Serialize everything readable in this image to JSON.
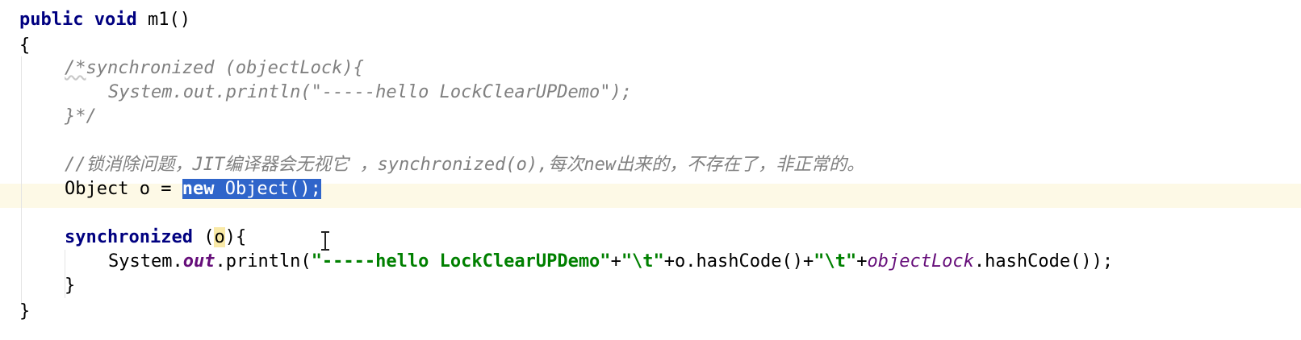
{
  "code": {
    "line1": {
      "kw1": "public",
      "kw2": "void",
      "rest": " m1()"
    },
    "line2": "{",
    "line3": {
      "slash": "/*",
      "rest": "synchronized (objectLock){"
    },
    "line4": "System.out.println(\"-----hello LockClearUPDemo\");",
    "line5": "}*/",
    "line6": "//锁消除问题，JIT编译器会无视它 ，synchronized(o),每次new出来的，不存在了，非正常的。",
    "line7": {
      "pre": "Object o = ",
      "sel_kw": "new",
      "sel_rest": " Object();"
    },
    "line8": {
      "kw": "synchronized",
      "open": " (",
      "var": "o",
      "close": "){"
    },
    "line9": {
      "p1": "System.",
      "field": "out",
      "p2": ".println(",
      "s1": "\"-----hello LockClearUPDemo\"",
      "p3": "+",
      "s2": "\"\\t\"",
      "p4": "+o.hashCode()+",
      "s3": "\"\\t\"",
      "p5": "+",
      "ifield": "objectLock",
      "p6": ".hashCode());"
    },
    "line10": "}",
    "line11": "}"
  },
  "colors": {
    "keyword": "#000080",
    "comment": "#808080",
    "string": "#008000",
    "field": "#660e7a",
    "selection": "#2f65ca",
    "current_line": "#fdf9e6"
  },
  "icons": {
    "mouse_cursor": "i-beam-icon"
  }
}
